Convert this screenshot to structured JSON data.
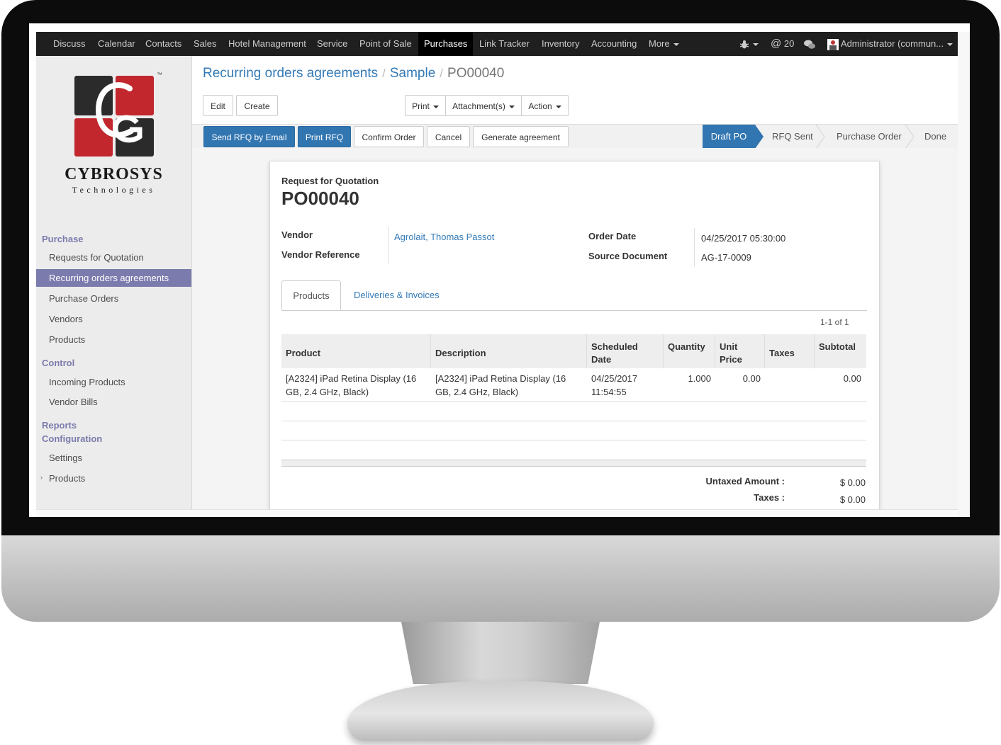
{
  "navbar": {
    "apps": [
      "Discuss",
      "Calendar",
      "Contacts",
      "Sales",
      "Hotel Management",
      "Service",
      "Point of Sale",
      "Purchases",
      "Link Tracker",
      "Inventory",
      "Accounting",
      "More"
    ],
    "active_app": "Purchases",
    "messages_count": "20",
    "user": "Administrator (commun..."
  },
  "brand": {
    "name": "CYBROSYS",
    "tagline": "Technologies",
    "tm": "™"
  },
  "sidebar": {
    "sections": [
      {
        "title": "Purchase",
        "items": [
          "Requests for Quotation",
          "Recurring orders agreements",
          "Purchase Orders",
          "Vendors",
          "Products"
        ]
      },
      {
        "title": "Control",
        "items": [
          "Incoming Products",
          "Vendor Bills"
        ]
      },
      {
        "title": "Reports",
        "items": []
      },
      {
        "title": "Configuration",
        "items": [
          "Settings",
          "Products"
        ]
      }
    ],
    "active_item": "Recurring orders agreements"
  },
  "breadcrumb": {
    "level1": "Recurring orders agreements",
    "level2": "Sample",
    "current": "PO00040",
    "sep": "/"
  },
  "toolbar": {
    "edit": "Edit",
    "create": "Create",
    "print": "Print",
    "attachments": "Attachment(s)",
    "action": "Action"
  },
  "header_buttons": {
    "send_rfq": "Send RFQ by Email",
    "print_rfq": "Print RFQ",
    "confirm": "Confirm Order",
    "cancel": "Cancel",
    "generate": "Generate agreement"
  },
  "stages": [
    "Draft PO",
    "RFQ Sent",
    "Purchase Order",
    "Done"
  ],
  "active_stage": "Draft PO",
  "form": {
    "doc_type": "Request for Quotation",
    "name": "PO00040",
    "vendor_label": "Vendor",
    "vendor": "Agrolait, Thomas Passot",
    "vendor_ref_label": "Vendor Reference",
    "order_date_label": "Order Date",
    "order_date": "04/25/2017 05:30:00",
    "source_label": "Source Document",
    "source": "AG-17-0009"
  },
  "tabs": [
    "Products",
    "Deliveries & Invoices"
  ],
  "active_tab": "Products",
  "table": {
    "pager": "1-1 of 1",
    "headers": {
      "product": "Product",
      "description": "Description",
      "scheduled_1": "Scheduled",
      "scheduled_2": "Date",
      "quantity": "Quantity",
      "unit_1": "Unit",
      "unit_2": "Price",
      "taxes": "Taxes",
      "subtotal": "Subtotal"
    },
    "row": {
      "product_1": "[A2324] iPad Retina Display (16",
      "product_2": "GB, 2.4 GHz, Black)",
      "description_1": "[A2324] iPad Retina Display (16",
      "description_2": "GB, 2.4 GHz, Black)",
      "date_1": "04/25/2017",
      "date_2": "11:54:55",
      "quantity": "1.000",
      "unit_price": "0.00",
      "taxes": "",
      "subtotal": "0.00"
    }
  },
  "totals": {
    "untaxed_label": "Untaxed Amount :",
    "untaxed": "$ 0.00",
    "taxes_label": "Taxes :",
    "taxes": "$ 0.00"
  },
  "colors": {
    "accent": "#7c7bad",
    "primary": "#3276b1",
    "link": "#337ab7",
    "navbar": "#1f1f1f"
  }
}
